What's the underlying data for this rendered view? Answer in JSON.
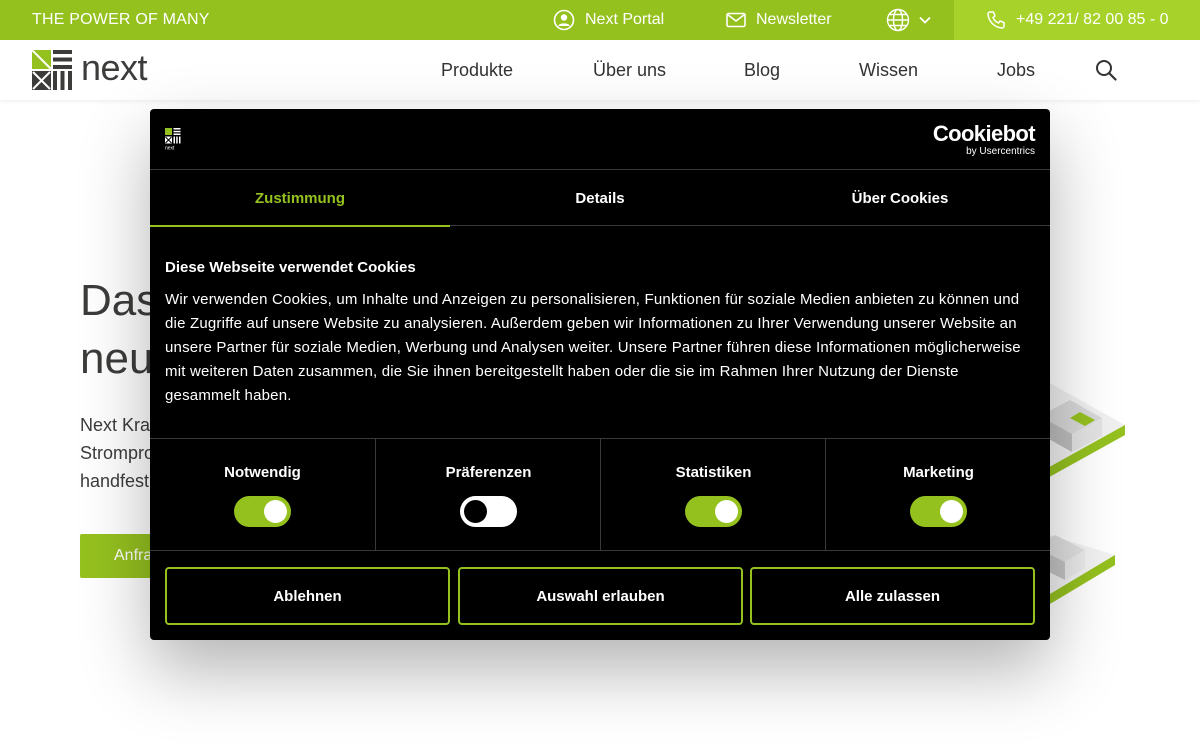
{
  "topbar": {
    "slogan": "THE POWER OF MANY",
    "portal_label": "Next Portal",
    "newsletter_label": "Newsletter",
    "phone": "+49 221/ 82 00 85 - 0"
  },
  "header": {
    "logo_text": "next",
    "nav": [
      "Produkte",
      "Über uns",
      "Blog",
      "Wissen",
      "Jobs"
    ]
  },
  "hero": {
    "title_line1": "Das",
    "title_line2": "neu",
    "text_line1": "Next Kra",
    "text_line2": "Strompro",
    "text_line3": "handfest",
    "button_label": "Anfra"
  },
  "cookie_dialog": {
    "brand": "Cookiebot",
    "brand_sub": "by Usercentrics",
    "logo_small_text": "next",
    "tabs": [
      "Zustimmung",
      "Details",
      "Über Cookies"
    ],
    "active_tab": 0,
    "title": "Diese Webseite verwendet Cookies",
    "body": "Wir verwenden Cookies, um Inhalte und Anzeigen zu personalisieren, Funktionen für soziale Medien anbieten zu können und die Zugriffe auf unsere Website zu analysieren. Außerdem geben wir Informationen zu Ihrer Verwendung unserer Website an unsere Partner für soziale Medien, Werbung und Analysen weiter. Unsere Partner führen diese Informationen möglicherweise mit weiteren Daten zusammen, die Sie ihnen bereitgestellt haben oder die sie im Rahmen Ihrer Nutzung der Dienste gesammelt haben.",
    "categories": [
      {
        "label": "Notwendig",
        "enabled": true
      },
      {
        "label": "Präferenzen",
        "enabled": false
      },
      {
        "label": "Statistiken",
        "enabled": true
      },
      {
        "label": "Marketing",
        "enabled": true
      }
    ],
    "buttons": {
      "decline": "Ablehnen",
      "allow_selection": "Auswahl erlauben",
      "allow_all": "Alle zulassen"
    }
  },
  "colors": {
    "brand_green": "#95c11f",
    "phone_bar": "#a6d22a",
    "dialog_bg": "#000000"
  },
  "icons": [
    "user-circle-icon",
    "mail-icon",
    "globe-icon",
    "chevron-down-icon",
    "phone-icon",
    "search-icon"
  ]
}
